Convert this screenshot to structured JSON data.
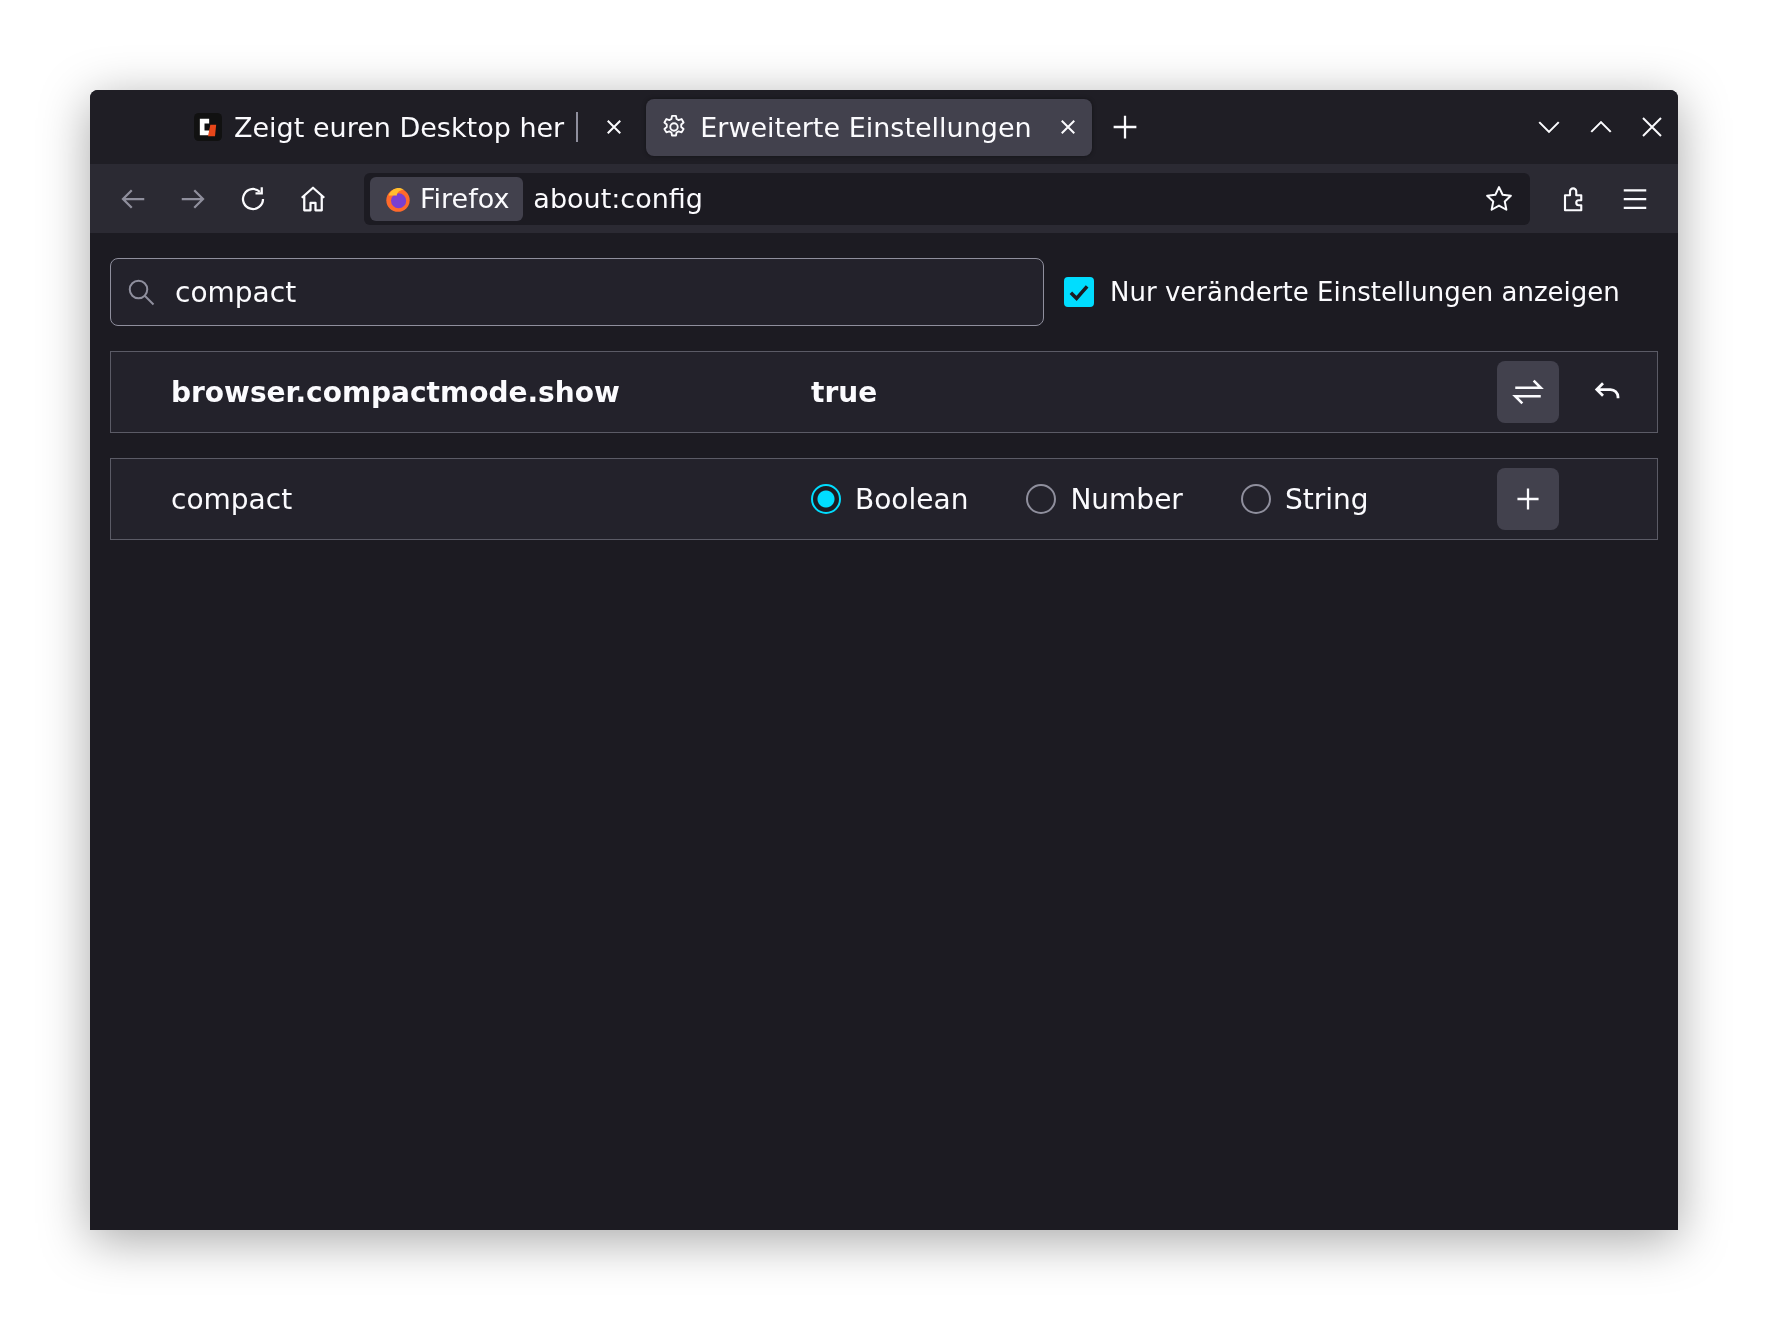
{
  "tabs": [
    {
      "label": "Zeigt euren Desktop her",
      "selected": false
    },
    {
      "label": "Erweiterte Einstellungen",
      "selected": true
    }
  ],
  "identity": "Firefox",
  "url": "about:config",
  "search": {
    "value": "compact"
  },
  "filter": {
    "label": "Nur veränderte Einstellungen anzeigen",
    "checked": true
  },
  "prefs": [
    {
      "name": "browser.compactmode.show",
      "value": "true",
      "modified": true
    }
  ],
  "new_pref": {
    "name": "compact",
    "types": [
      {
        "label": "Boolean",
        "selected": true
      },
      {
        "label": "Number",
        "selected": false
      },
      {
        "label": "String",
        "selected": false
      }
    ]
  }
}
